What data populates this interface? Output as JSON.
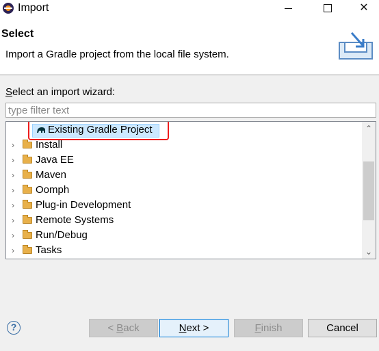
{
  "window": {
    "title": "Import",
    "min_glyph": "—",
    "close_glyph": "✕"
  },
  "header": {
    "title": "Select",
    "description": "Import a Gradle project from the local file system."
  },
  "wizard": {
    "label": "Select an import wizard:",
    "filter_placeholder": "type filter text",
    "selected_item": "Existing Gradle Project",
    "items": [
      {
        "label": "Install"
      },
      {
        "label": "Java EE"
      },
      {
        "label": "Maven"
      },
      {
        "label": "Oomph"
      },
      {
        "label": "Plug-in Development"
      },
      {
        "label": "Remote Systems"
      },
      {
        "label": "Run/Debug"
      },
      {
        "label": "Tasks"
      }
    ],
    "chevron": "›",
    "scroll_up": "⌃",
    "scroll_down": "⌄"
  },
  "footer": {
    "help": "?",
    "back": {
      "pre": "< ",
      "mnemonic": "B",
      "post": "ack"
    },
    "next": {
      "mnemonic": "N",
      "post": "ext >"
    },
    "finish": {
      "mnemonic": "F",
      "post": "inish"
    },
    "cancel": "Cancel"
  },
  "colors": {
    "selection_fill": "#cce8ff",
    "highlight_border": "#ee1c1c",
    "default_button_border": "#0078d7"
  }
}
